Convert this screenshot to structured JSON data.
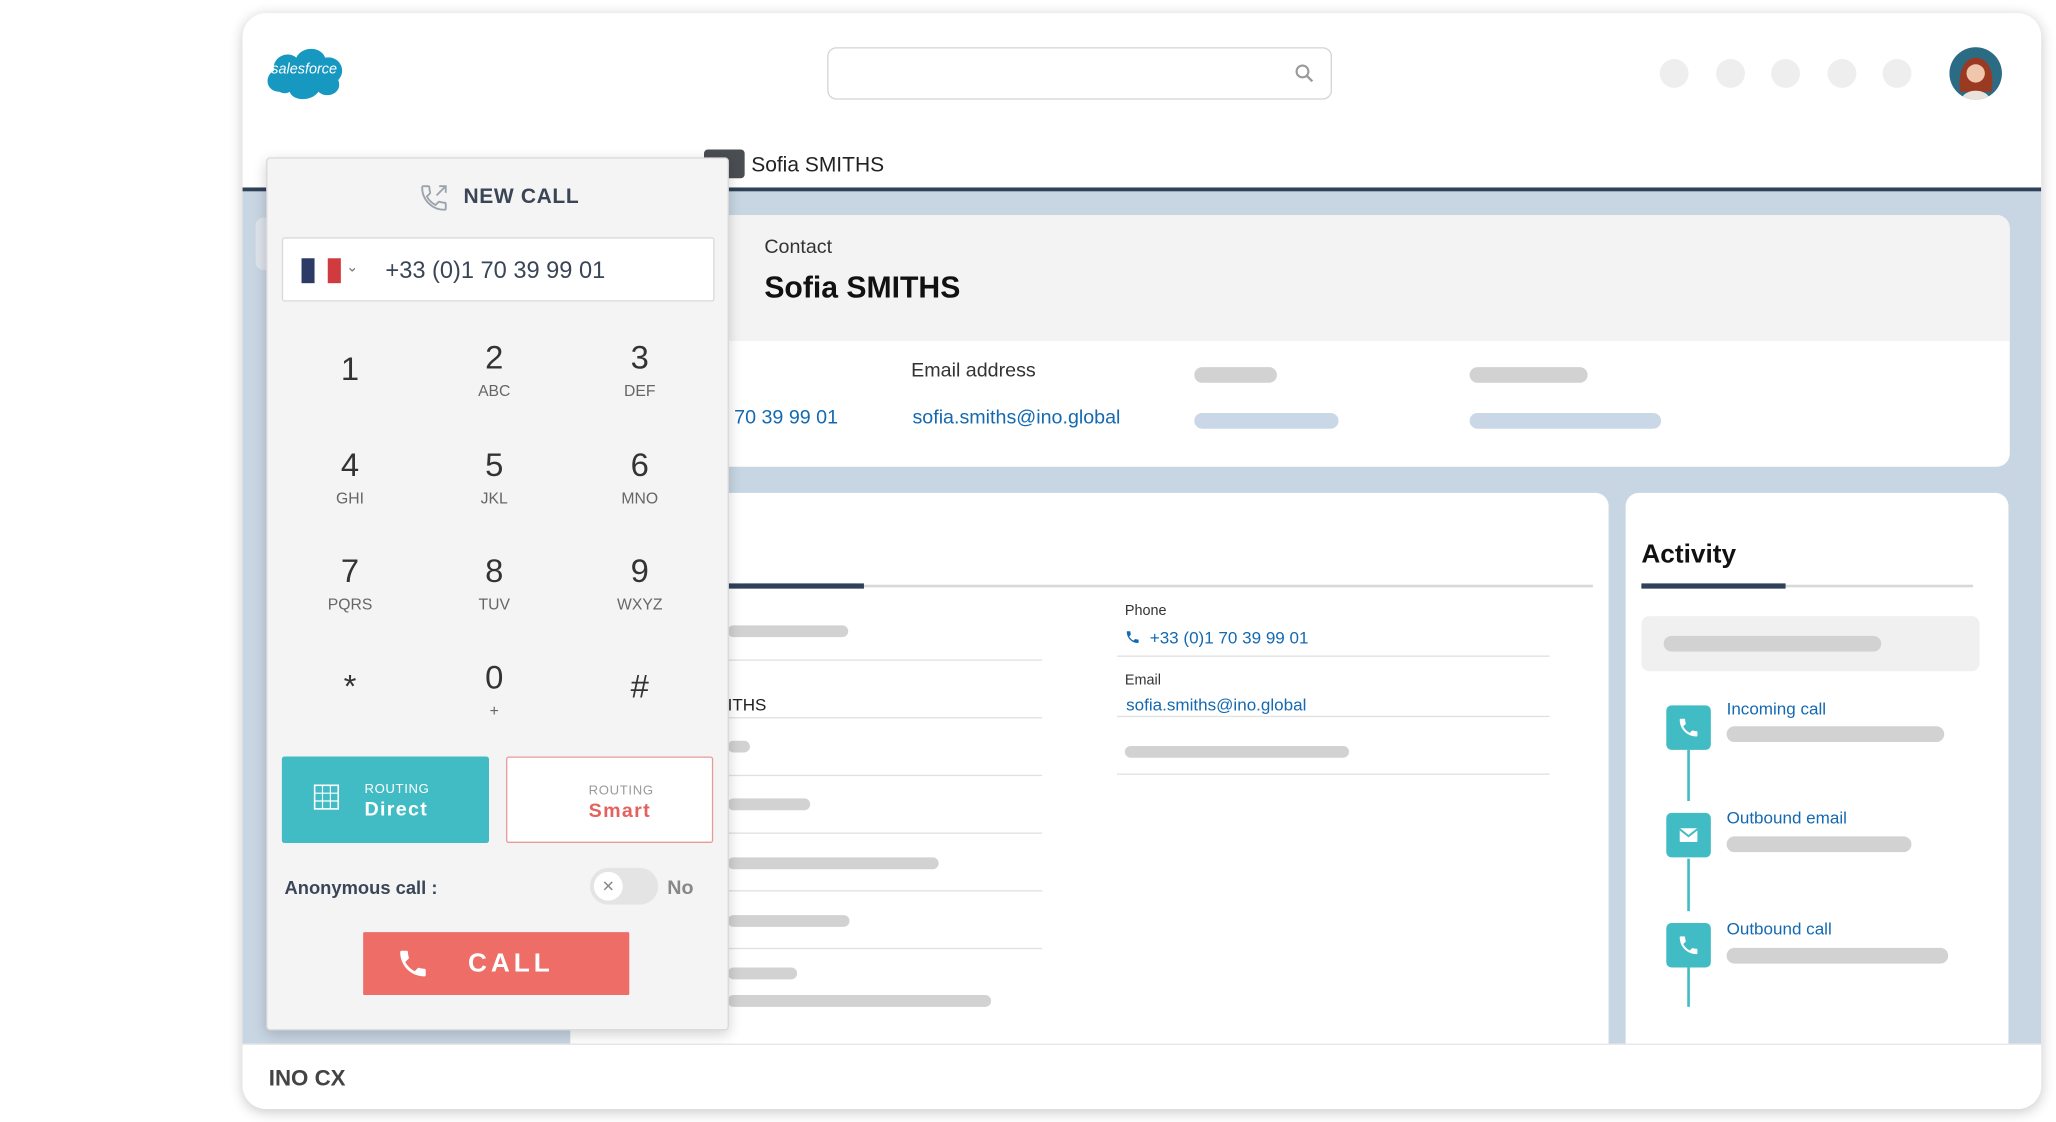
{
  "brand": {
    "logo_text": "salesforce",
    "footer": "INO CX"
  },
  "tab": {
    "label": "Sofia SMITHS"
  },
  "contact": {
    "type": "Contact",
    "name": "Sofia SMITHS",
    "email_header": "Email address",
    "phone_partial": "70 39 99 01",
    "email": "sofia.smiths@ino.global"
  },
  "details": {
    "name_partial": "ITHS",
    "phone_label": "Phone",
    "phone_value": "+33 (0)1 70 39 99 01",
    "email_label": "Email",
    "email_value": "sofia.smiths@ino.global"
  },
  "activity": {
    "title": "Activity",
    "items": [
      {
        "label": "Incoming call",
        "icon": "phone-icon"
      },
      {
        "label": "Outbound email",
        "icon": "mail-icon"
      },
      {
        "label": "Outbound call",
        "icon": "phone-icon"
      }
    ]
  },
  "dialer": {
    "title": "NEW CALL",
    "country": "France",
    "number": "+33 (0)1 70 39 99 01",
    "keys": [
      {
        "n": "1",
        "l": ""
      },
      {
        "n": "2",
        "l": "ABC"
      },
      {
        "n": "3",
        "l": "DEF"
      },
      {
        "n": "4",
        "l": "GHI"
      },
      {
        "n": "5",
        "l": "JKL"
      },
      {
        "n": "6",
        "l": "MNO"
      },
      {
        "n": "7",
        "l": "PQRS"
      },
      {
        "n": "8",
        "l": "TUV"
      },
      {
        "n": "9",
        "l": "WXYZ"
      },
      {
        "n": "*",
        "l": ""
      },
      {
        "n": "0",
        "l": "+"
      },
      {
        "n": "#",
        "l": ""
      }
    ],
    "routing_small": "ROUTING",
    "routing_direct": "Direct",
    "routing_smart": "Smart",
    "anonymous_label": "Anonymous call :",
    "anonymous_state": "No",
    "call_label": "CALL"
  },
  "colors": {
    "teal": "#42bcc4",
    "call_red": "#ee6d67",
    "link_blue": "#1469b1",
    "navy": "#2f4259"
  }
}
